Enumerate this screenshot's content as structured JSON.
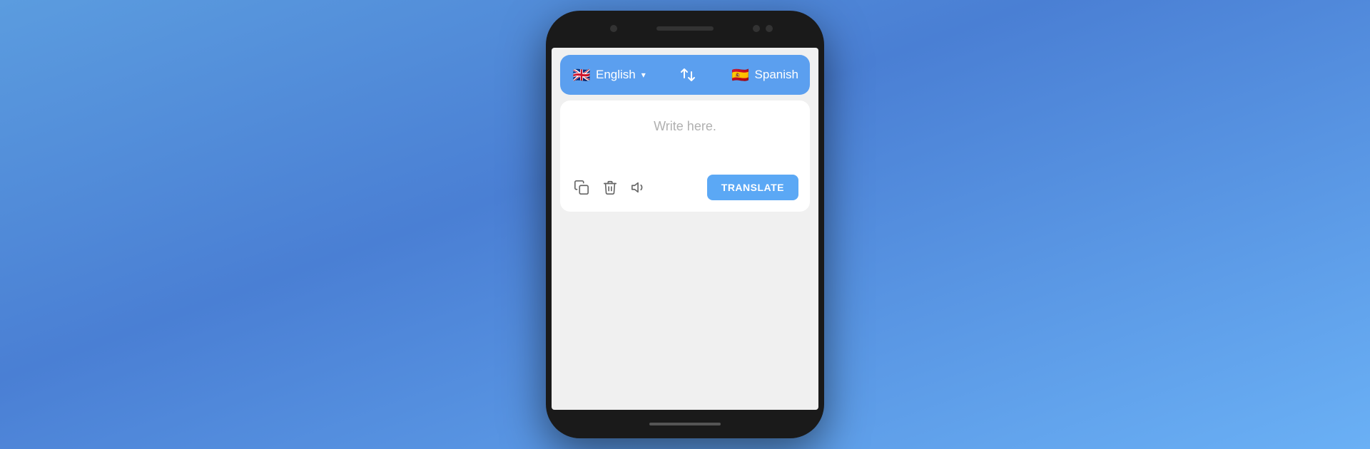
{
  "background": {
    "gradient_start": "#5b9cdf",
    "gradient_end": "#6ab0f5"
  },
  "phone": {
    "frame_color": "#1a1a1a"
  },
  "language_bar": {
    "background": "#5b9fef",
    "source": {
      "flag": "🇬🇧",
      "name": "English",
      "has_dropdown": true
    },
    "swap_icon": "⇄",
    "target": {
      "flag": "🇪🇸",
      "name": "Spanish"
    }
  },
  "input": {
    "placeholder": "Write here.",
    "background": "#ffffff"
  },
  "actions": {
    "copy_label": "Copy",
    "delete_label": "Delete",
    "volume_label": "Volume",
    "translate_button": "TRANSLATE",
    "translate_bg": "#5ba8f5"
  }
}
